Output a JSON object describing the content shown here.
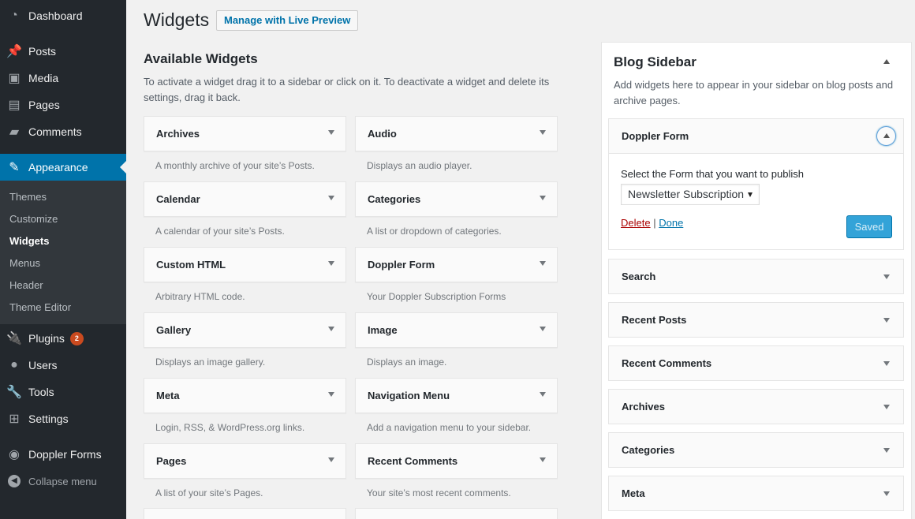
{
  "sidebar": {
    "items": [
      {
        "label": "Dashboard",
        "icon": "dashboard-icon"
      },
      {
        "label": "Posts",
        "icon": "pin-icon"
      },
      {
        "label": "Media",
        "icon": "media-icon"
      },
      {
        "label": "Pages",
        "icon": "pages-icon"
      },
      {
        "label": "Comments",
        "icon": "comment-icon"
      },
      {
        "label": "Appearance",
        "icon": "brush-icon"
      },
      {
        "label": "Plugins",
        "icon": "plugin-icon",
        "badge": "2"
      },
      {
        "label": "Users",
        "icon": "user-icon"
      },
      {
        "label": "Tools",
        "icon": "wrench-icon"
      },
      {
        "label": "Settings",
        "icon": "settings-icon"
      },
      {
        "label": "Doppler Forms",
        "icon": "doppler-icon"
      },
      {
        "label": "Collapse menu",
        "icon": "collapse-icon"
      }
    ],
    "submenu": [
      "Themes",
      "Customize",
      "Widgets",
      "Menus",
      "Header",
      "Theme Editor"
    ],
    "accent": "#0073aa"
  },
  "header": {
    "title": "Widgets",
    "live_preview": "Manage with Live Preview"
  },
  "available": {
    "title": "Available Widgets",
    "description": "To activate a widget drag it to a sidebar or click on it. To deactivate a widget and delete its settings, drag it back.",
    "widgets": [
      {
        "name": "Archives",
        "desc": "A monthly archive of your site’s Posts."
      },
      {
        "name": "Audio",
        "desc": "Displays an audio player."
      },
      {
        "name": "Calendar",
        "desc": "A calendar of your site’s Posts."
      },
      {
        "name": "Categories",
        "desc": "A list or dropdown of categories."
      },
      {
        "name": "Custom HTML",
        "desc": "Arbitrary HTML code."
      },
      {
        "name": "Doppler Form",
        "desc": "Your Doppler Subscription Forms"
      },
      {
        "name": "Gallery",
        "desc": "Displays an image gallery."
      },
      {
        "name": "Image",
        "desc": "Displays an image."
      },
      {
        "name": "Meta",
        "desc": "Login, RSS, & WordPress.org links."
      },
      {
        "name": "Navigation Menu",
        "desc": "Add a navigation menu to your sidebar."
      },
      {
        "name": "Pages",
        "desc": "A list of your site’s Pages."
      },
      {
        "name": "Recent Comments",
        "desc": "Your site’s most recent comments."
      }
    ]
  },
  "blog_sidebar": {
    "title": "Blog Sidebar",
    "description": "Add widgets here to appear in your sidebar on blog posts and archive pages.",
    "open_widget": {
      "title": "Doppler Form",
      "label": "Select the Form that you want to publish",
      "selected": "Newsletter Subscription",
      "delete": "Delete",
      "separator": "|",
      "done": "Done",
      "saved": "Saved"
    },
    "widgets": [
      "Search",
      "Recent Posts",
      "Recent Comments",
      "Archives",
      "Categories",
      "Meta"
    ]
  }
}
